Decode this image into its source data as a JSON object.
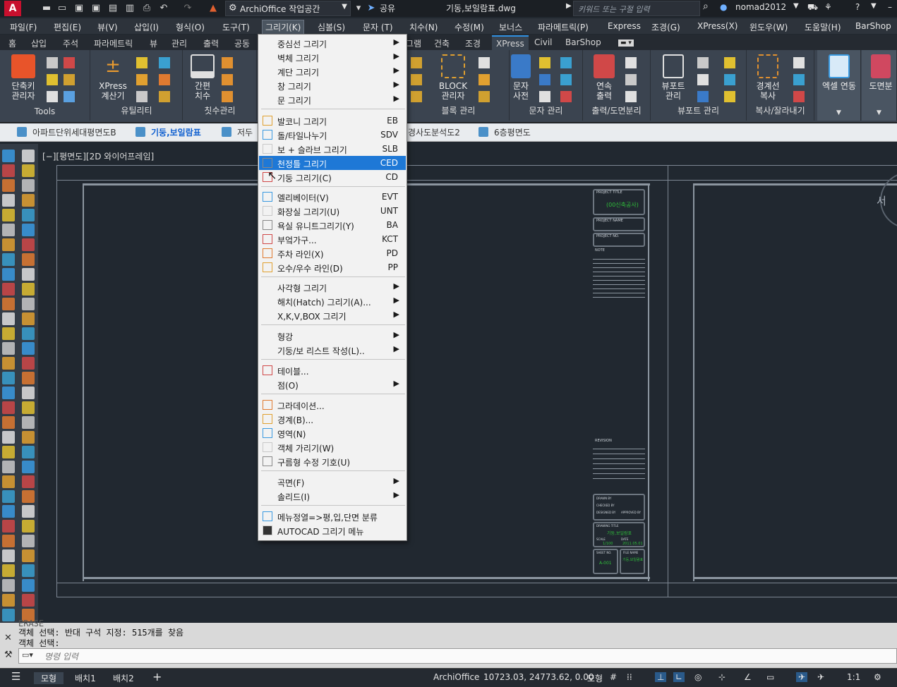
{
  "titlebar": {
    "app_logo": "A",
    "workspace": "ArchiOffice 작업공간",
    "share_label": "공유",
    "filename": "기동,보일람표.dwg",
    "search_placeholder": "키워드 또는 구절 입력",
    "user": "nomad2012"
  },
  "menubar": [
    "파일(F)",
    "편집(E)",
    "뷰(V)",
    "삽입(I)",
    "형식(O)",
    "도구(T)",
    "그리기(K)",
    "심볼(S)",
    "문자 (T)",
    "치수(N)",
    "수정(M)",
    "보너스",
    "파라메트릭(P)",
    "Express",
    "조경(G)",
    "XPress(X)",
    "윈도우(W)",
    "도움말(H)",
    "BarShop"
  ],
  "ribbon_tabs": [
    "홈",
    "삽입",
    "주석",
    "파라메트릭",
    "뷰",
    "관리",
    "출력",
    "공동",
    "그램",
    "건축",
    "조경",
    "XPress",
    "Civil",
    "BarShop"
  ],
  "ribbon_active_tab": "XPress",
  "ribbon": {
    "tools_title": "Tools",
    "shortcut_label1": "단축키",
    "shortcut_label2": "관리자",
    "utility_title": "유틸리티",
    "xpress_calc1": "XPress",
    "xpress_calc2": "계산기",
    "dim_title": "칫수관리",
    "dim_btn1": "간편",
    "dim_btn2": "치수",
    "block_title": "블록 관리",
    "block_btn1": "BLOCK",
    "block_btn2": "관리자",
    "text_title": "문자 관리",
    "text_btn1": "문자",
    "text_btn2": "사전",
    "output_title": "출력/도면분리",
    "output_btn1": "연속",
    "output_btn2": "출력",
    "viewport_title": "뷰포트 관리",
    "viewport_btn1": "뷰포트",
    "viewport_btn2": "관리",
    "copy_title": "복사/잘라내기",
    "copy_btn1": "경계선",
    "copy_btn2": "복사",
    "excel_btn": "엑셀 연동",
    "sheet_btn": "도면분"
  },
  "file_tabs": [
    {
      "label": "아파트단위세대평면도B",
      "active": false
    },
    {
      "label": "기둥,보일람표",
      "active": true
    },
    {
      "label": "저두",
      "active": false
    },
    {
      "label": "경사도분석도2",
      "active": false
    },
    {
      "label": "6층평면도",
      "active": false
    }
  ],
  "viewport_label": "[−][평면도][2D 와이어프레임]",
  "viewcube_label": "서",
  "title_block": {
    "project_title_hdr": "PROJECT TITLE",
    "project_title_val": "(00신축공사)",
    "project_name_hdr": "PROJECT NAME",
    "project_no_hdr": "PROJECT NO.",
    "note_hdr": "NOTE",
    "revision_hdr": "REVISION",
    "drawn_by": "DRAWN BY",
    "checked_by": "CHECKED BY",
    "designed_by": "DESIGNED BY",
    "approved_by": "APPROVED BY",
    "drawing_title_hdr": "DRAWING TITLE",
    "drawing_title_val": "기둥,보일람표",
    "scale_hdr": "SCALE",
    "scale_val": "1/100",
    "date_hdr": "DATE",
    "date_val": "2011.05.01",
    "sheet_no_hdr": "SHEET NO.",
    "sheet_no_val": "A-001",
    "file_name_hdr": "FILE NAME",
    "file_name_val": "기둥,보일람표"
  },
  "dropdown": {
    "g1": [
      {
        "label": "중심선 그리기",
        "arrow": true
      },
      {
        "label": "벽체 그리기",
        "arrow": true
      },
      {
        "label": "계단 그리기",
        "arrow": true
      },
      {
        "label": "창 그리기",
        "arrow": true
      },
      {
        "label": "문 그리기",
        "arrow": true
      }
    ],
    "g2": [
      {
        "label": "발코니 그리기",
        "shortcut": "EB"
      },
      {
        "label": "돌/타일나누기",
        "shortcut": "SDV"
      },
      {
        "label": "보 + 슬라브 그리기",
        "shortcut": "SLB"
      },
      {
        "label": "천정틀 그리기",
        "shortcut": "CED"
      },
      {
        "label": "기둥 그리기(C)",
        "shortcut": "CD"
      }
    ],
    "g3": [
      {
        "label": "엘리베이터(V)",
        "shortcut": "EVT"
      },
      {
        "label": "화장실 그리기(U)",
        "shortcut": "UNT"
      },
      {
        "label": "욕실 유니트그리기(Y)",
        "shortcut": "BA"
      },
      {
        "label": "부엌가구...",
        "shortcut": "KCT"
      },
      {
        "label": "주차 라인(X)",
        "shortcut": "PD"
      },
      {
        "label": "오수/우수 라인(D)",
        "shortcut": "PP"
      }
    ],
    "g4": [
      {
        "label": "사각형 그리기",
        "arrow": true
      },
      {
        "label": "해치(Hatch) 그리기(A)...",
        "arrow": true
      },
      {
        "label": "X,K,V,BOX 그리기",
        "arrow": true
      }
    ],
    "g5": [
      {
        "label": "형강",
        "arrow": true
      },
      {
        "label": "기둥/보 리스트 작성(L)..",
        "arrow": true
      }
    ],
    "g6": [
      {
        "label": "테이블...",
        "arrow": false
      },
      {
        "label": "점(O)",
        "arrow": true
      }
    ],
    "g7": [
      {
        "label": "그라데이션..."
      },
      {
        "label": "경계(B)..."
      },
      {
        "label": "영역(N)"
      },
      {
        "label": "객체 가리기(W)"
      },
      {
        "label": "구름형 수정 기호(U)"
      }
    ],
    "g8": [
      {
        "label": "곡면(F)",
        "arrow": true
      },
      {
        "label": "솔리드(I)",
        "arrow": true
      }
    ],
    "g9": [
      {
        "label": "메뉴정열=>평,입,단면 분류"
      },
      {
        "label": "AUTOCAD 그리기 메뉴"
      }
    ],
    "highlighted": "천정틀 그리기"
  },
  "command": {
    "line0": "ERASE",
    "line1": "객체 선택: 반대 구석 지정: 515개를 찾음",
    "line2": "객체 선택:",
    "placeholder": "명령 입력"
  },
  "status": {
    "layout_model": "모형",
    "layout1": "배치1",
    "layout2": "배치2",
    "app": "ArchiOffice",
    "coords": "10723.03, 24773.62, 0.00",
    "mode": "모형",
    "scale": "1:1"
  },
  "colors": {
    "accent": "#1e78d6",
    "canvas_bg": "#212830",
    "tb_green": "#2fbf3a"
  }
}
